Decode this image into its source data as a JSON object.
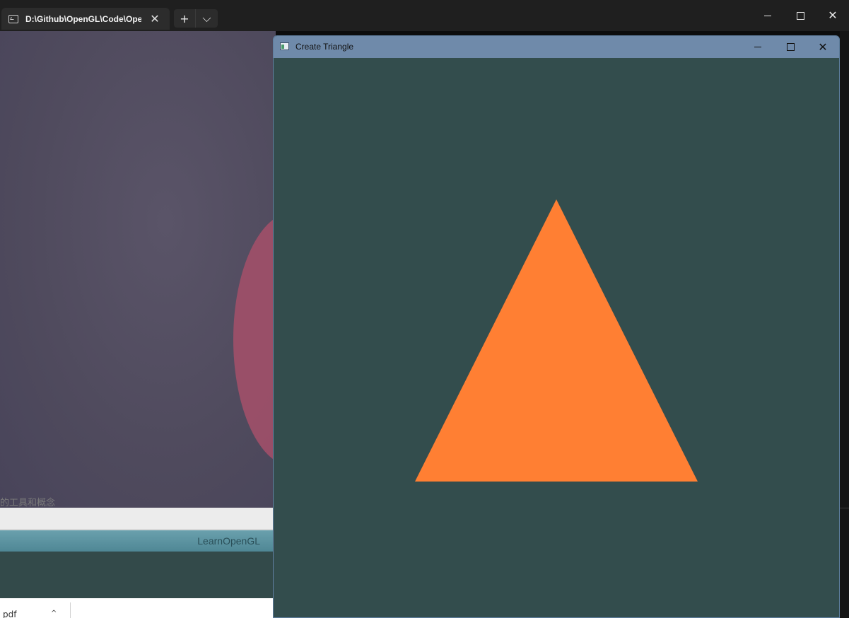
{
  "terminal": {
    "tab_title": "D:\\Github\\OpenGL\\Code\\OpenGL",
    "tab_close_glyph": "✕",
    "newtab_glyph": "+",
    "dropdown_glyph": "⌵",
    "close_glyph": "✕"
  },
  "browser": {
    "site_label": "LearnOpenGL",
    "page_text_fragment": "的工具和概念",
    "download_file": "pdf",
    "download_chevron": "^"
  },
  "gl_window": {
    "title": "Create Triangle",
    "close_glyph": "✕",
    "clear_color": "#334d4d",
    "triangle_color": "#ff7f33"
  }
}
